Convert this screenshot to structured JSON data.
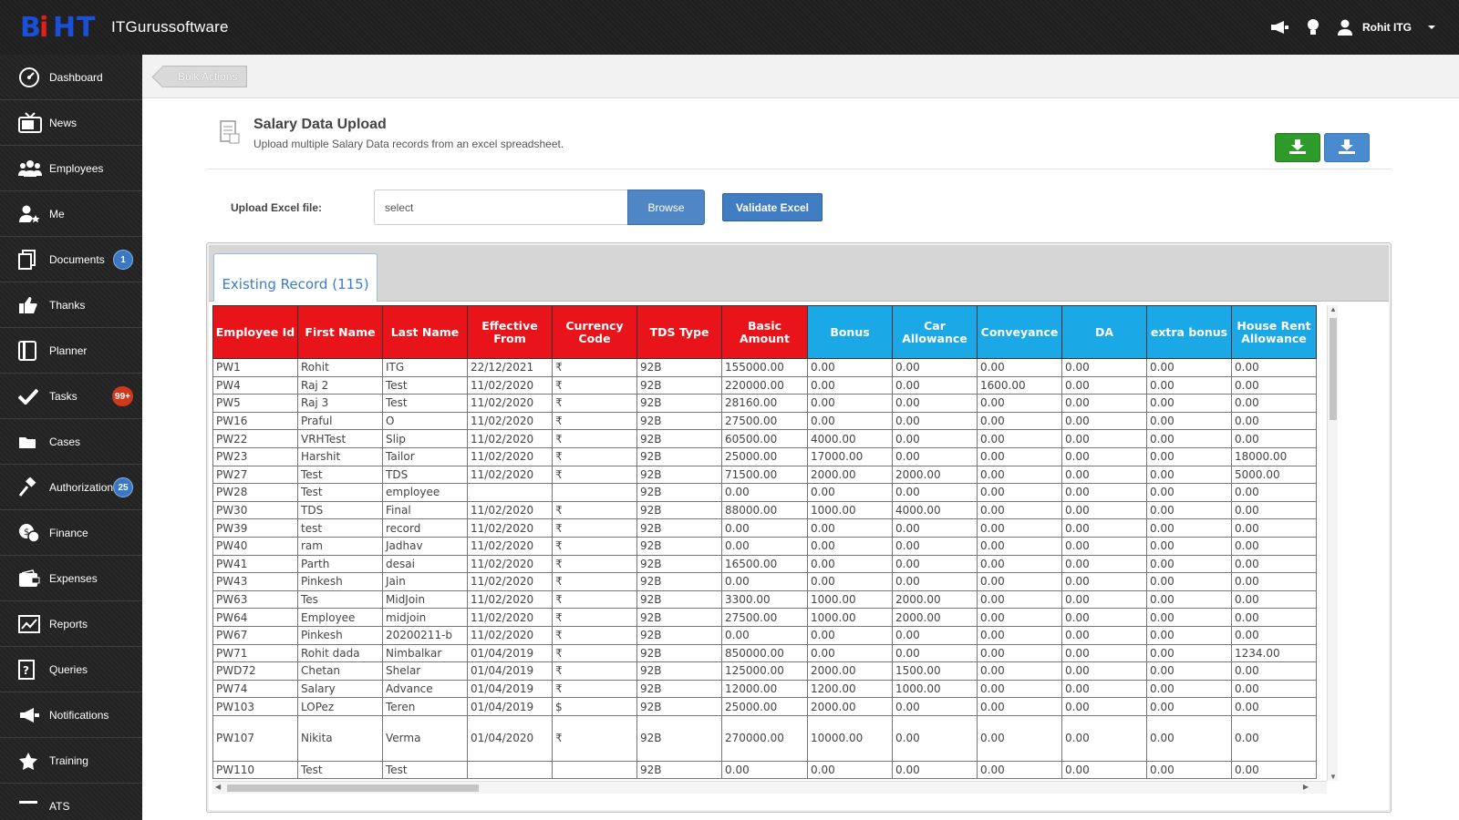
{
  "app": {
    "brand": "ITGurussoftware",
    "logo_text": "BiHT",
    "user": "Rohit ITG"
  },
  "sidebar": {
    "items": [
      {
        "label": "Dashboard",
        "icon": "dashboard-icon"
      },
      {
        "label": "News",
        "icon": "tv-icon"
      },
      {
        "label": "Employees",
        "icon": "users-icon"
      },
      {
        "label": "Me",
        "icon": "user-star-icon"
      },
      {
        "label": "Documents",
        "icon": "documents-icon",
        "badge": "1"
      },
      {
        "label": "Thanks",
        "icon": "thumbs-up-icon"
      },
      {
        "label": "Planner",
        "icon": "planner-icon"
      },
      {
        "label": "Tasks",
        "icon": "check-icon",
        "badge": "99+"
      },
      {
        "label": "Cases",
        "icon": "folder-icon"
      },
      {
        "label": "Authorizations",
        "icon": "gavel-icon",
        "badge": "25"
      },
      {
        "label": "Finance",
        "icon": "coins-icon"
      },
      {
        "label": "Expenses",
        "icon": "wallet-icon"
      },
      {
        "label": "Reports",
        "icon": "chart-line-icon"
      },
      {
        "label": "Queries",
        "icon": "question-doc-icon"
      },
      {
        "label": "Notifications",
        "icon": "megaphone-icon"
      },
      {
        "label": "Training",
        "icon": "star-icon"
      },
      {
        "label": "ATS",
        "icon": "ats-icon"
      }
    ]
  },
  "toolbar": {
    "bulk_actions": "Bulk Actions"
  },
  "page": {
    "title": "Salary Data Upload",
    "subtitle": "Upload multiple Salary Data records from an excel spreadsheet."
  },
  "upload": {
    "label": "Upload Excel file:",
    "value": "select",
    "browse": "Browse",
    "validate": "Validate Excel"
  },
  "tab": {
    "label": "Existing Record (115)"
  },
  "table": {
    "headers": [
      {
        "label": "Employee Id",
        "color": "red"
      },
      {
        "label": "First Name",
        "color": "red"
      },
      {
        "label": "Last Name",
        "color": "red"
      },
      {
        "label": "Effective From",
        "color": "red"
      },
      {
        "label": "Currency Code",
        "color": "red"
      },
      {
        "label": "TDS Type",
        "color": "red"
      },
      {
        "label": "Basic Amount",
        "color": "red"
      },
      {
        "label": "Bonus",
        "color": "blue"
      },
      {
        "label": "Car Allowance",
        "color": "blue"
      },
      {
        "label": "Conveyance",
        "color": "blue"
      },
      {
        "label": "DA",
        "color": "blue"
      },
      {
        "label": "extra bonus",
        "color": "blue"
      },
      {
        "label": "House Rent Allowance",
        "color": "blue"
      }
    ],
    "rows": [
      [
        "PW1",
        "Rohit",
        "ITG",
        "22/12/2021",
        "₹",
        "92B",
        "155000.00",
        "0.00",
        "0.00",
        "0.00",
        "0.00",
        "0.00",
        "0.00"
      ],
      [
        "PW4",
        "Raj 2",
        "Test",
        "11/02/2020",
        "₹",
        "92B",
        "220000.00",
        "0.00",
        "0.00",
        "1600.00",
        "0.00",
        "0.00",
        "0.00"
      ],
      [
        "PW5",
        "Raj 3",
        "Test",
        "11/02/2020",
        "₹",
        "92B",
        "28160.00",
        "0.00",
        "0.00",
        "0.00",
        "0.00",
        "0.00",
        "0.00"
      ],
      [
        "PW16",
        "Praful",
        "O",
        "11/02/2020",
        "₹",
        "92B",
        "27500.00",
        "0.00",
        "0.00",
        "0.00",
        "0.00",
        "0.00",
        "0.00"
      ],
      [
        "PW22",
        "VRHTest",
        "Slip",
        "11/02/2020",
        "₹",
        "92B",
        "60500.00",
        "4000.00",
        "0.00",
        "0.00",
        "0.00",
        "0.00",
        "0.00"
      ],
      [
        "PW23",
        "Harshit",
        "Tailor",
        "11/02/2020",
        "₹",
        "92B",
        "25000.00",
        "17000.00",
        "0.00",
        "0.00",
        "0.00",
        "0.00",
        "18000.00"
      ],
      [
        "PW27",
        "Test",
        "TDS",
        "11/02/2020",
        "₹",
        "92B",
        "71500.00",
        "2000.00",
        "2000.00",
        "0.00",
        "0.00",
        "0.00",
        "5000.00"
      ],
      [
        "PW28",
        "Test",
        "employee",
        "",
        "",
        "92B",
        "0.00",
        "0.00",
        "0.00",
        "0.00",
        "0.00",
        "0.00",
        "0.00"
      ],
      [
        "PW30",
        "TDS",
        "Final",
        "11/02/2020",
        "₹",
        "92B",
        "88000.00",
        "1000.00",
        "4000.00",
        "0.00",
        "0.00",
        "0.00",
        "0.00"
      ],
      [
        "PW39",
        "test",
        "record",
        "11/02/2020",
        "₹",
        "92B",
        "0.00",
        "0.00",
        "0.00",
        "0.00",
        "0.00",
        "0.00",
        "0.00"
      ],
      [
        "PW40",
        "ram",
        "Jadhav",
        "11/02/2020",
        "₹",
        "92B",
        "0.00",
        "0.00",
        "0.00",
        "0.00",
        "0.00",
        "0.00",
        "0.00"
      ],
      [
        "PW41",
        "Parth",
        "desai",
        "11/02/2020",
        "₹",
        "92B",
        "16500.00",
        "0.00",
        "0.00",
        "0.00",
        "0.00",
        "0.00",
        "0.00"
      ],
      [
        "PW43",
        "Pinkesh",
        "Jain",
        "11/02/2020",
        "₹",
        "92B",
        "0.00",
        "0.00",
        "0.00",
        "0.00",
        "0.00",
        "0.00",
        "0.00"
      ],
      [
        "PW63",
        "Tes",
        "MidJoin",
        "11/02/2020",
        "₹",
        "92B",
        "3300.00",
        "1000.00",
        "2000.00",
        "0.00",
        "0.00",
        "0.00",
        "0.00"
      ],
      [
        "PW64",
        "Employee",
        "midjoin",
        "11/02/2020",
        "₹",
        "92B",
        "27500.00",
        "1000.00",
        "2000.00",
        "0.00",
        "0.00",
        "0.00",
        "0.00"
      ],
      [
        "PW67",
        "Pinkesh",
        "20200211-b",
        "11/02/2020",
        "₹",
        "92B",
        "0.00",
        "0.00",
        "0.00",
        "0.00",
        "0.00",
        "0.00",
        "0.00"
      ],
      [
        "PW71",
        "Rohit dada",
        "Nimbalkar",
        "01/04/2019",
        "₹",
        "92B",
        "850000.00",
        "0.00",
        "0.00",
        "0.00",
        "0.00",
        "0.00",
        "1234.00"
      ],
      [
        "PWD72",
        "Chetan",
        "Shelar",
        "01/04/2019",
        "₹",
        "92B",
        "125000.00",
        "2000.00",
        "1500.00",
        "0.00",
        "0.00",
        "0.00",
        "0.00"
      ],
      [
        "PW74",
        "Salary",
        "Advance",
        "01/04/2019",
        "₹",
        "92B",
        "12000.00",
        "1200.00",
        "1000.00",
        "0.00",
        "0.00",
        "0.00",
        "0.00"
      ],
      [
        "PW103",
        "LOPez",
        "Teren",
        "01/04/2019",
        "$",
        "92B",
        "25000.00",
        "2000.00",
        "0.00",
        "0.00",
        "0.00",
        "0.00",
        "0.00"
      ],
      [
        "PW107",
        "Nikita",
        "Verma",
        "01/04/2020",
        "₹",
        "92B",
        "270000.00",
        "10000.00",
        "0.00",
        "0.00",
        "0.00",
        "0.00",
        "0.00"
      ],
      [
        "PW110",
        "Test",
        "Test",
        "",
        "",
        "92B",
        "0.00",
        "0.00",
        "0.00",
        "0.00",
        "0.00",
        "0.00",
        "0.00"
      ]
    ],
    "tall_rows": [
      20
    ]
  }
}
